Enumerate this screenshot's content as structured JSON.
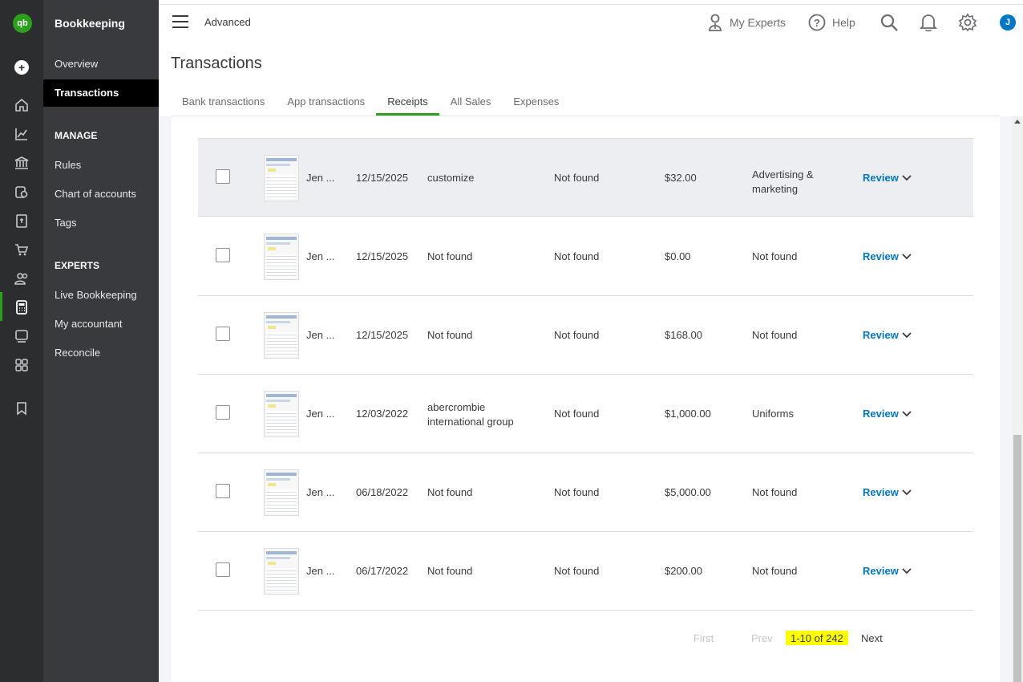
{
  "app": {
    "logo": "qb",
    "section_title": "Bookkeeping",
    "mode": "Advanced",
    "avatar_initial": "J"
  },
  "rail_icons": [
    "home-icon",
    "chart-icon",
    "bank-icon",
    "transactions-icon",
    "invoice-icon",
    "cart-icon",
    "people-icon",
    "calculator-icon",
    "payroll-icon",
    "apps-icon",
    "bookmark-icon"
  ],
  "nav": {
    "overview": "Overview",
    "transactions": "Transactions",
    "manage_header": "MANAGE",
    "rules": "Rules",
    "chart_of_accounts": "Chart of accounts",
    "tags": "Tags",
    "experts_header": "EXPERTS",
    "live_bookkeeping": "Live Bookkeeping",
    "my_accountant": "My accountant",
    "reconcile": "Reconcile"
  },
  "topbar": {
    "my_experts": "My Experts",
    "help": "Help"
  },
  "page": {
    "title": "Transactions"
  },
  "tabs": [
    "Bank transactions",
    "App transactions",
    "Receipts",
    "All Sales",
    "Expenses"
  ],
  "active_tab": "Receipts",
  "rows": [
    {
      "from": "Jen ...",
      "date": "12/15/2025",
      "payee": "customize",
      "account": "Not found",
      "amount": "$32.00",
      "category": "Advertising & marketing",
      "action": "Review"
    },
    {
      "from": "Jen ...",
      "date": "12/15/2025",
      "payee": "Not found",
      "account": "Not found",
      "amount": "$0.00",
      "category": "Not found",
      "action": "Review"
    },
    {
      "from": "Jen ...",
      "date": "12/15/2025",
      "payee": "Not found",
      "account": "Not found",
      "amount": "$168.00",
      "category": "Not found",
      "action": "Review"
    },
    {
      "from": "Jen ...",
      "date": "12/03/2022",
      "payee": "abercrombie international group",
      "account": "Not found",
      "amount": "$1,000.00",
      "category": "Uniforms",
      "action": "Review"
    },
    {
      "from": "Jen ...",
      "date": "06/18/2022",
      "payee": "Not found",
      "account": "Not found",
      "amount": "$5,000.00",
      "category": "Not found",
      "action": "Review"
    },
    {
      "from": "Jen ...",
      "date": "06/17/2022",
      "payee": "Not found",
      "account": "Not found",
      "amount": "$200.00",
      "category": "Not found",
      "action": "Review"
    }
  ],
  "pagination": {
    "first": "First",
    "prev": "Prev",
    "range": "1-10 of 242",
    "next": "Next"
  },
  "colors": {
    "brand_green": "#2ca01c",
    "link_blue": "#0077c5",
    "highlight": "#ffff00"
  }
}
